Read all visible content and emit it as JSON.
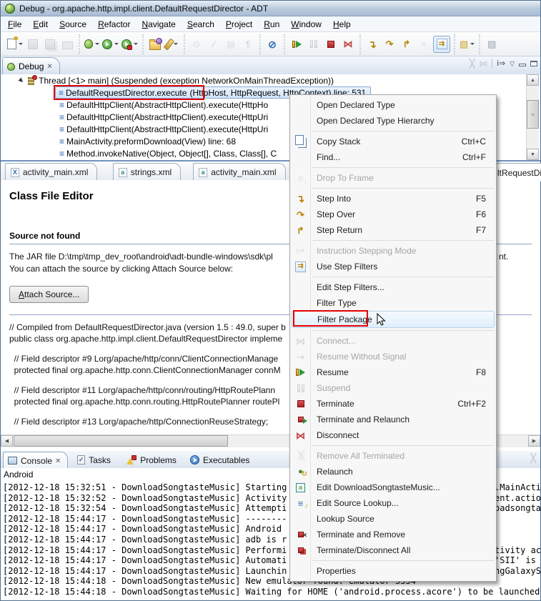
{
  "window": {
    "title": "Debug - org.apache.http.impl.client.DefaultRequestDirector - ADT"
  },
  "menubar": [
    "File",
    "Edit",
    "Source",
    "Refactor",
    "Navigate",
    "Search",
    "Project",
    "Run",
    "Window",
    "Help"
  ],
  "toolbar": {
    "groups": [
      [
        {
          "name": "new-wizard",
          "icon": "new",
          "dropdown": true
        },
        {
          "name": "save",
          "icon": "floppy",
          "disabled": true
        },
        {
          "name": "save-all",
          "icon": "floppy-all",
          "disabled": true
        },
        {
          "name": "print",
          "icon": "print",
          "disabled": true
        }
      ],
      [
        {
          "name": "debug",
          "icon": "bug",
          "dropdown": true
        },
        {
          "name": "run",
          "icon": "run",
          "dropdown": true
        },
        {
          "name": "run-external-tools",
          "icon": "run-ext",
          "dropdown": true
        }
      ],
      [
        {
          "name": "open-task",
          "icon": "folder"
        },
        {
          "name": "search",
          "icon": "flashlight",
          "dropdown": true
        }
      ],
      [
        {
          "name": "pin-editor",
          "icon": "pin",
          "disabled": true
        },
        {
          "name": "next-annotation",
          "icon": "pencil",
          "disabled": true
        },
        {
          "name": "last-edit-location",
          "icon": "table",
          "disabled": true
        },
        {
          "name": "show-whitespace",
          "icon": "pilcrow",
          "disabled": true
        }
      ],
      [
        {
          "name": "skip-all-breakpoints",
          "icon": "skip-bp"
        }
      ],
      [
        {
          "name": "resume",
          "icon": "resume"
        },
        {
          "name": "suspend",
          "icon": "suspend",
          "disabled": true
        },
        {
          "name": "terminate",
          "icon": "terminate"
        },
        {
          "name": "disconnect",
          "icon": "disconnect-red"
        }
      ],
      [
        {
          "name": "step-into",
          "icon": "step-into"
        },
        {
          "name": "step-over",
          "icon": "step-over"
        },
        {
          "name": "step-return",
          "icon": "step-return"
        },
        {
          "name": "drop-to-frame",
          "icon": "drop-frame",
          "disabled": true
        },
        {
          "name": "use-step-filters",
          "icon": "usf",
          "toggled": true
        }
      ],
      [
        {
          "name": "mark-occurrences",
          "icon": "mark",
          "dropdown": true
        }
      ],
      [
        {
          "name": "clipped-button",
          "icon": "clipped"
        }
      ]
    ]
  },
  "debug_view": {
    "title": "Debug",
    "thread": "Thread [<1> main] (Suspended (exception NetworkOnMainThreadException))",
    "frames": [
      {
        "selected": true,
        "highlight": "DefaultRequestDirector.execute",
        "rest": "(HttpHost, HttpRequest, HttpContext) line: 531"
      },
      {
        "text": "DefaultHttpClient(AbstractHttpClient).execute(HttpHo"
      },
      {
        "text": "DefaultHttpClient(AbstractHttpClient).execute(HttpUri"
      },
      {
        "text": "DefaultHttpClient(AbstractHttpClient).execute(HttpUri"
      },
      {
        "text": "MainActivity.preformDownload(View) line: 68"
      },
      {
        "text": "Method.invokeNative(Object, Object[], Class, Class[], C"
      }
    ]
  },
  "editor": {
    "tabs": [
      {
        "label": "activity_main.xml",
        "icon": "xml-x"
      },
      {
        "label": "strings.xml",
        "icon": "xml-a"
      },
      {
        "label": "activity_main.xml",
        "icon": "xml-a"
      }
    ],
    "partial_tab": "ltRequestDi",
    "heading": "Class File Editor",
    "subheading": "Source not found",
    "line1": "The JAR file D:\\tmp\\tmp_dev_root\\android\\adt-bundle-windows\\sdk\\pl",
    "line1_right": "nt.",
    "line2": "You can attach the source by clicking Attach Source below:",
    "attach_button": "Attach Source...",
    "code": [
      "// Compiled from DefaultRequestDirector.java (version 1.5 : 49.0, super b",
      "public class org.apache.http.impl.client.DefaultRequestDirector impleme",
      "",
      "  // Field descriptor #9 Lorg/apache/http/conn/ClientConnectionManage",
      "  protected final org.apache.http.conn.ClientConnectionManager connM",
      "",
      "  // Field descriptor #11 Lorg/apache/http/conn/routing/HttpRoutePlann",
      "  protected final org.apache.http.conn.routing.HttpRoutePlanner routePl",
      "",
      "  // Field descriptor #13 Lorg/apache/http/ConnectionReuseStrategy;"
    ]
  },
  "console": {
    "tabs": [
      {
        "label": "Console",
        "icon": "console",
        "selected": true
      },
      {
        "label": "Tasks",
        "icon": "tasks"
      },
      {
        "label": "Problems",
        "icon": "problems"
      },
      {
        "label": "Executables",
        "icon": "exec"
      }
    ],
    "process_label": "Android",
    "lines": [
      {
        "t": "[2012-12-18 15:32:51 - DownloadSongtasteMusic] Starting",
        "r": ".MainActi"
      },
      {
        "t": "[2012-12-18 15:32:52 - DownloadSongtasteMusic] Activity",
        "r": "ent.actio"
      },
      {
        "t": "[2012-12-18 15:32:54 - DownloadSongtasteMusic] Attempti",
        "r": "oadsongta"
      },
      {
        "t": "[2012-12-18 15:44:17 - DownloadSongtasteMusic] --------",
        "r": ""
      },
      {
        "t": "[2012-12-18 15:44:17 - DownloadSongtasteMusic] Android ",
        "r": ""
      },
      {
        "t": "[2012-12-18 15:44:17 - DownloadSongtasteMusic] adb is r",
        "r": ""
      },
      {
        "t": "[2012-12-18 15:44:17 - DownloadSongtasteMusic] Performi",
        "r": "tivity ac"
      },
      {
        "t": "[2012-12-18 15:44:17 - DownloadSongtasteMusic] Automati",
        "r": "'SII' is "
      },
      {
        "t": "[2012-12-18 15:44:17 - DownloadSongtasteMusic] Launchin",
        "r": "ngGalaxyS"
      },
      {
        "t": "[2012-12-18 15:44:18 - DownloadSongtasteMusic] New emulator found: emulator-5554",
        "r": ""
      },
      {
        "t": "[2012-12-18 15:44:18 - DownloadSongtasteMusic] Waiting for HOME ('android.process.acore') to be launched...",
        "r": ""
      }
    ]
  },
  "context_menu": {
    "items": [
      {
        "label": "Open Declared Type"
      },
      {
        "label": "Open Declared Type Hierarchy"
      },
      {
        "sep": true
      },
      {
        "label": "Copy Stack",
        "shortcut": "Ctrl+C",
        "icon": "copy"
      },
      {
        "label": "Find...",
        "shortcut": "Ctrl+F"
      },
      {
        "sep": true
      },
      {
        "label": "Drop To Frame",
        "icon": "drop-frame",
        "disabled": true
      },
      {
        "sep": true
      },
      {
        "label": "Step Into",
        "shortcut": "F5",
        "icon": "step-into"
      },
      {
        "label": "Step Over",
        "shortcut": "F6",
        "icon": "step-over"
      },
      {
        "label": "Step Return",
        "shortcut": "F7",
        "icon": "step-return"
      },
      {
        "sep": true
      },
      {
        "label": "Instruction Stepping Mode",
        "icon": "ism",
        "disabled": true
      },
      {
        "label": "Use Step Filters",
        "icon": "usf"
      },
      {
        "sep": true
      },
      {
        "label": "Edit Step Filters..."
      },
      {
        "label": "Filter Type"
      },
      {
        "label": "Filter Package",
        "hover": true,
        "redbox": true,
        "cursor": true
      },
      {
        "sep": true
      },
      {
        "label": "Connect...",
        "icon": "connect",
        "disabled": true
      },
      {
        "label": "Resume Without Signal",
        "icon": "rws",
        "disabled": true
      },
      {
        "label": "Resume",
        "shortcut": "F8",
        "icon": "resume"
      },
      {
        "label": "Suspend",
        "icon": "suspend",
        "disabled": true
      },
      {
        "label": "Terminate",
        "shortcut": "Ctrl+F2",
        "icon": "terminate"
      },
      {
        "label": "Terminate and Relaunch",
        "icon": "term-relaunch"
      },
      {
        "label": "Disconnect",
        "icon": "disconnect-red"
      },
      {
        "sep": true
      },
      {
        "label": "Remove All Terminated",
        "icon": "remove-all",
        "disabled": true
      },
      {
        "label": "Relaunch",
        "icon": "relaunch"
      },
      {
        "label": "Edit DownloadSongtasteMusic...",
        "icon": "edit-config"
      },
      {
        "label": "Edit Source Lookup...",
        "icon": "edit-lookup"
      },
      {
        "label": "Lookup Source"
      },
      {
        "label": "Terminate and Remove",
        "icon": "term-remove"
      },
      {
        "label": "Terminate/Disconnect All",
        "icon": "term-disc-all"
      },
      {
        "sep": true
      },
      {
        "label": "Properties"
      }
    ]
  },
  "colors": {
    "red_box": "#e60000",
    "selection_border": "#86abd4",
    "menu_hover_border": "#b5d3ef"
  }
}
